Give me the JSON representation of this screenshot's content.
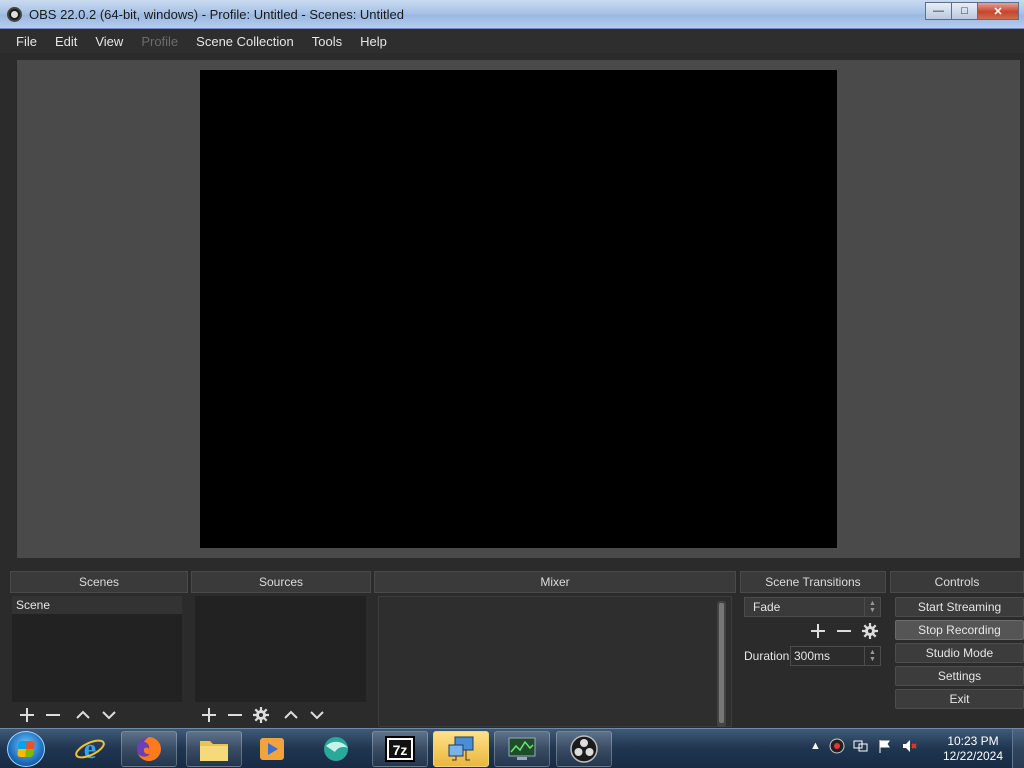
{
  "window": {
    "title": "OBS 22.0.2 (64-bit, windows) - Profile: Untitled - Scenes: Untitled",
    "minimize_glyph": "—",
    "maximize_glyph": "□",
    "close_glyph": "✕"
  },
  "menu": {
    "items": [
      {
        "label": "File",
        "enabled": true
      },
      {
        "label": "Edit",
        "enabled": true
      },
      {
        "label": "View",
        "enabled": true
      },
      {
        "label": "Profile",
        "enabled": false
      },
      {
        "label": "Scene Collection",
        "enabled": true
      },
      {
        "label": "Tools",
        "enabled": true
      },
      {
        "label": "Help",
        "enabled": true
      }
    ]
  },
  "docks": {
    "scenes": {
      "title": "Scenes",
      "items": [
        "Scene"
      ]
    },
    "sources": {
      "title": "Sources",
      "items": []
    },
    "mixer": {
      "title": "Mixer"
    },
    "transitions": {
      "title": "Scene Transitions",
      "selected": "Fade",
      "duration_label": "Duration",
      "duration_value": "300ms"
    },
    "controls": {
      "title": "Controls",
      "buttons": [
        {
          "label": "Start Streaming",
          "active": false
        },
        {
          "label": "Stop Recording",
          "active": true
        },
        {
          "label": "Studio Mode",
          "active": false
        },
        {
          "label": "Settings",
          "active": false
        },
        {
          "label": "Exit",
          "active": false
        }
      ]
    }
  },
  "taskbar": {
    "apps": [
      "internet-explorer",
      "firefox",
      "file-explorer",
      "media-player",
      "browser-app",
      "7-zip",
      "remote-desktop",
      "network-monitor",
      "obs-studio"
    ],
    "tray_icons": [
      "show-hidden-icons-arrow",
      "obs-recording",
      "network",
      "action-center-flag",
      "volume-muted"
    ],
    "time": "10:23 PM",
    "date": "12/22/2024"
  },
  "colors": {
    "background": "#2b2b2b",
    "preview_bg": "#4a4a4a",
    "canvas": "#000000",
    "dock_list": "#222222",
    "taskbar": "#1f3550"
  }
}
